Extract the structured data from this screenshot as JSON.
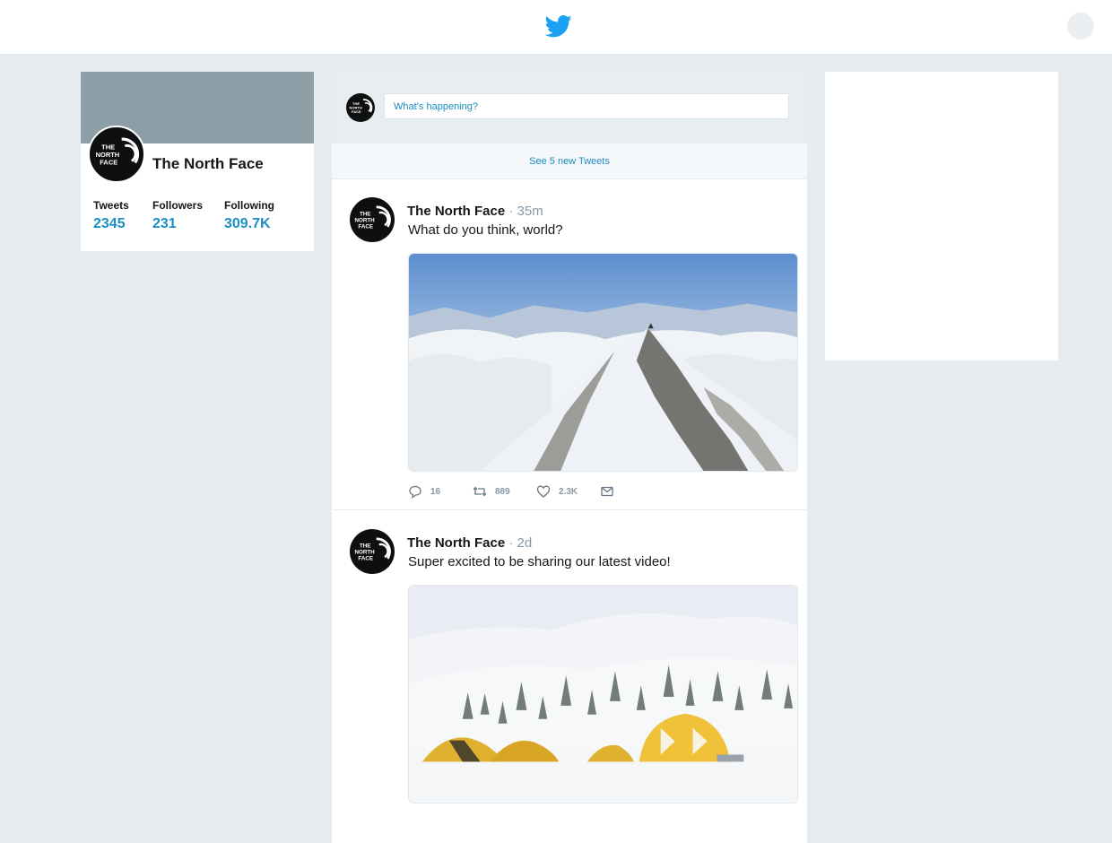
{
  "header": {
    "logo_icon": "twitter-bird-icon",
    "brand_color": "#1da1f2"
  },
  "profile": {
    "name": "The North Face",
    "avatar_text": [
      "THE",
      "NORTH",
      "FACE"
    ],
    "stats": [
      {
        "label": "Tweets",
        "value": "2345"
      },
      {
        "label": "Followers",
        "value": "231"
      },
      {
        "label": "Following",
        "value": "309.7K"
      }
    ]
  },
  "compose": {
    "placeholder": "What’s happening?"
  },
  "new_tweets_label": "See 5 new Tweets",
  "tweets": [
    {
      "author": "The North Face",
      "time": "· 35m",
      "text": "What do you think, world?",
      "image": "snowy-mountain-summit-photo",
      "replies": "16",
      "retweets": "889",
      "likes": "2.3K"
    },
    {
      "author": "The North Face",
      "time": "· 2d",
      "text": "Super excited to be sharing our latest video!",
      "image": "snow-camp-tents-photo"
    }
  ],
  "colors": {
    "accent": "#1b8ec4",
    "muted": "#8899a6",
    "background": "#e6ecf0"
  }
}
